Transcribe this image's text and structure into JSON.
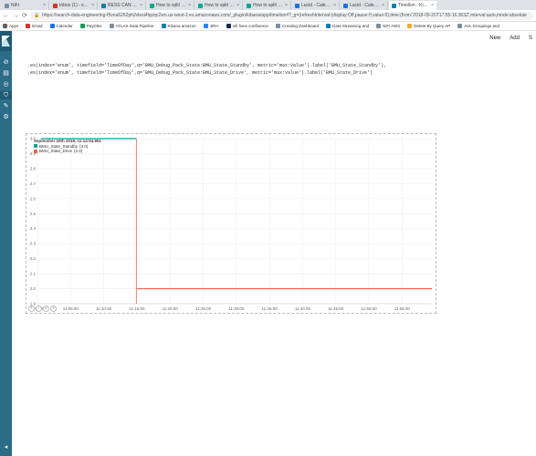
{
  "browser": {
    "tabs": [
      {
        "label": "NiFi",
        "color": "#7a8fa0",
        "active": false
      },
      {
        "label": "Inbox (1) - shraddhasrivastav@c...",
        "color": "#d93025",
        "active": false
      },
      {
        "label": "RESS CAN Dashboard - Kibana",
        "color": "#0b7fb0",
        "active": false
      },
      {
        "label": "How to split lines based on a fie...",
        "color": "#00a98f",
        "active": false
      },
      {
        "label": "How to split lines based on a fie...",
        "color": "#00a98f",
        "active": false
      },
      {
        "label": "How to split lines based on a fie...",
        "color": "#00a98f",
        "active": false
      },
      {
        "label": "Lucid - Calendar - Wednesday, J...",
        "color": "#1a73e8",
        "active": false
      },
      {
        "label": "Lucid - Calendar - Wednesday, J...",
        "color": "#1a73e8",
        "active": false
      },
      {
        "label": "Timelion - Kibana",
        "color": "#0b7fb0",
        "active": true
      }
    ],
    "nav": {
      "back": "←",
      "forward": "→",
      "reload": "⟳"
    },
    "url": "https://search-data-engineering-f5vna6262ph2vlesi4lqzqc2sm.us-west-2.es.amazonaws.com/_plugin/kibana/app/timelion#?_g=(refreshInterval:(display:Off,pause:!f,value:0),time:(from:'2018-09-20T17:55:16.363Z',interval:auto,mode:absolute",
    "bookmarks": [
      {
        "label": "Apps",
        "color": "#5f6368"
      },
      {
        "label": "Email",
        "color": "#d93025"
      },
      {
        "label": "Calendar",
        "color": "#1a73e8"
      },
      {
        "label": "PayDlex",
        "color": "#0f9d58"
      },
      {
        "label": "ATLAS Data Pipeline",
        "color": "#7a8fa0"
      },
      {
        "label": "Kibana amazon",
        "color": "#0b7fb0"
      },
      {
        "label": "JIRA",
        "color": "#2684ff"
      },
      {
        "label": "nifi fixes confluence",
        "color": "#172b4d"
      },
      {
        "label": "Creating Dashboard",
        "color": "#7a8fa0"
      },
      {
        "label": "Data Streaming and",
        "color": "#0b7fb0"
      },
      {
        "label": "NiFi AWS",
        "color": "#7a8fa0"
      },
      {
        "label": "Delete By Query AP",
        "color": "#f9a825"
      },
      {
        "label": "AVL Groupings and",
        "color": "#7a8fa0"
      }
    ]
  },
  "kibana": {
    "nav_icons": [
      {
        "name": "discover-icon",
        "glyph": "⊘",
        "selected": false
      },
      {
        "name": "visualize-icon",
        "glyph": "▤",
        "selected": false
      },
      {
        "name": "dashboard-icon",
        "glyph": "◎",
        "selected": false
      },
      {
        "name": "timelion-icon",
        "glyph": "⛉",
        "selected": true
      },
      {
        "name": "devtools-icon",
        "glyph": "✎",
        "selected": false
      },
      {
        "name": "management-icon",
        "glyph": "⚙",
        "selected": false
      }
    ],
    "collapse_glyph": "◂",
    "top_menu": {
      "new_label": "New",
      "add_label": "Add",
      "save_label": "S"
    },
    "expressions": [
      ".es(index='enum', timefield='TimeOfDay',q='BMU_Debug_Pack_State:BMU_State_Standby', metric='max:Value').label('BMU_State_Standby'),",
      ".es(index='enum', timefield='TimeOfDay',q='BMU_Debug_Pack_State:BMU_State_Drive', metric='max:Value').label('BMU_State_Drive')"
    ]
  },
  "chart_data": {
    "type": "line",
    "tooltip_title": "September 20th 2018, 11:14:54.951",
    "series": [
      {
        "name": "BMU_State_Standby",
        "hover_value": "(3.0)",
        "color": "#00a69b",
        "points": [
          [
            "11:00:30",
            3.0
          ],
          [
            "11:14:55",
            3.0
          ]
        ]
      },
      {
        "name": "BMU_State_Drive",
        "hover_value": "(2.0)",
        "color": "#e7664c",
        "points": [
          [
            "11:15:00",
            2.0
          ],
          [
            "11:59:30",
            2.0
          ]
        ]
      }
    ],
    "hover_time": "11:14:55",
    "x_ticks": [
      "11:00:00",
      "11:05:00",
      "11:10:00",
      "11:15:00",
      "11:20:00",
      "11:25:00",
      "11:30:00",
      "11:35:00",
      "11:40:00",
      "11:45:00",
      "11:50:00",
      "11:55:00"
    ],
    "y_ticks": [
      "1.9",
      "2.0",
      "2.1",
      "2.2",
      "2.3",
      "2.4",
      "2.5",
      "2.6",
      "2.7",
      "2.8",
      "2.9",
      "3.0"
    ],
    "xlim": [
      "11:00:00",
      "11:59:30"
    ],
    "ylim": [
      1.9,
      3.0
    ],
    "grid": true,
    "legend_position": "top-left",
    "zoom_buttons": [
      "+",
      "-",
      "«",
      "»"
    ]
  }
}
